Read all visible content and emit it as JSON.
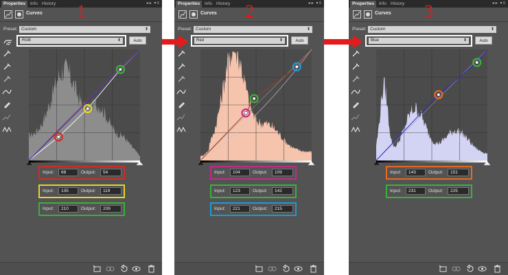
{
  "tabs": [
    "Properties",
    "Info",
    "History"
  ],
  "tab_controls": "▸▸ ▾≡",
  "panel_title": "Curves",
  "preset_label": "Preset:",
  "preset_value": "Custom",
  "auto_label": "Auto",
  "input_label": "Input:",
  "output_label": "Output:",
  "panels": [
    {
      "step": "1",
      "channel": "RGB",
      "hist_color": "#8d8d8d",
      "rows": [
        {
          "input": "68",
          "output": "54",
          "color": "#d42a24"
        },
        {
          "input": "135",
          "output": "119",
          "color": "#e8d52a"
        },
        {
          "input": "210",
          "output": "209",
          "color": "#39b23b"
        }
      ]
    },
    {
      "step": "2",
      "channel": "Red",
      "hist_color": "#f6c3ad",
      "rows": [
        {
          "input": "104",
          "output": "109",
          "color": "#c22a8c"
        },
        {
          "input": "123",
          "output": "142",
          "color": "#39b23b"
        },
        {
          "input": "221",
          "output": "215",
          "color": "#1e9ad8"
        }
      ]
    },
    {
      "step": "3",
      "channel": "Blue",
      "hist_color": "#d3d3f3",
      "rows": [
        {
          "input": "143",
          "output": "151",
          "color": "#ea6a20"
        },
        {
          "input": "231",
          "output": "225",
          "color": "#39b23b"
        }
      ]
    }
  ],
  "colors": {
    "panel_bg": "#535353",
    "tab_bar": "#2a2a2a",
    "step_number": "#d8201e",
    "flow_arrow": "#e51b1b",
    "curve_rgb": "#f2f2f2",
    "curve_red": "#a23a2c",
    "curve_blue": "#2a2ad8"
  },
  "icons": {
    "header": [
      "curves-adjustment-icon",
      "layer-mask-icon"
    ],
    "tools": [
      "on-image-adjust-icon",
      "sample-black-point-icon",
      "sample-gray-point-icon",
      "sample-white-point-icon",
      "curve-edit-icon",
      "pencil-icon",
      "smooth-icon",
      "clipping-warning-icon"
    ],
    "bottom": [
      "clip-to-layer-icon",
      "view-previous-state-icon",
      "reset-icon",
      "toggle-visibility-icon",
      "delete-icon"
    ]
  }
}
